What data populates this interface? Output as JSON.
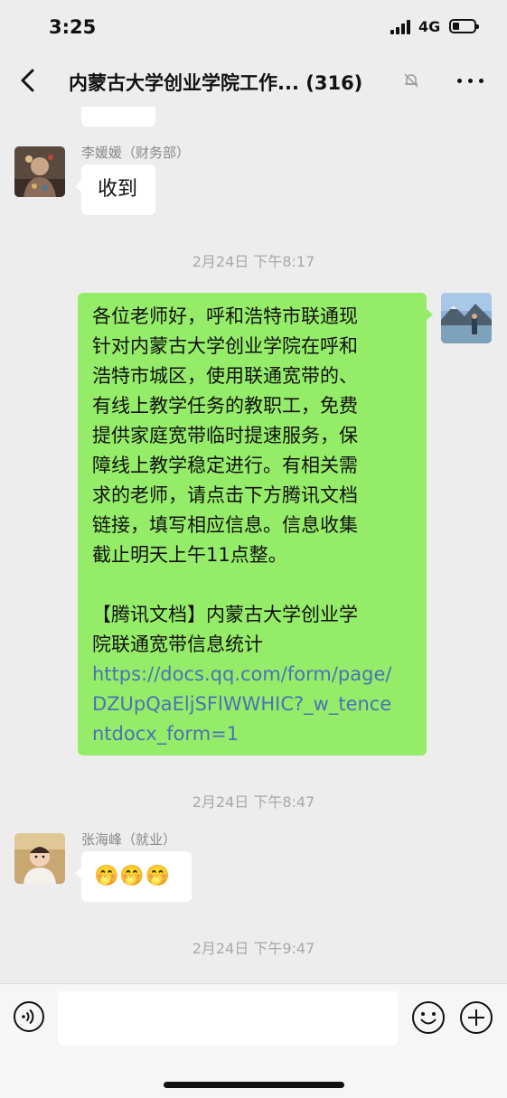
{
  "status_bar": {
    "time": "3:25",
    "network": "4G",
    "icons": [
      "signal-icon",
      "battery-icon"
    ]
  },
  "header": {
    "title": "内蒙古大学创业学院工作... (316)",
    "icons": [
      "back-arrow-icon",
      "mute-bell-icon",
      "more-icon"
    ]
  },
  "messages": [
    {
      "type": "incoming",
      "sender": "李媛媛（财务部）",
      "text": "收到",
      "avatar": "person-in-costume-avatar"
    },
    {
      "type": "timestamp",
      "text": "2月24日 下午8:17"
    },
    {
      "type": "outgoing",
      "avatar": "mountain-lake-avatar",
      "lines": [
        "各位老师好，呼和浩特市联通现",
        "针对内蒙古大学创业学院在呼和",
        "浩特市城区，使用联通宽带的、",
        "有线上教学任务的教职工，免费",
        "提供家庭宽带临时提速服务，保",
        "障线上教学稳定进行。有相关需",
        "求的老师，请点击下方腾讯文档",
        "链接，填写相应信息。信息收集",
        "截止明天上午11点整。",
        "",
        "【腾讯文档】内蒙古大学创业学",
        "院联通宽带信息统计"
      ],
      "link_lines": [
        "https://docs.qq.com/form/page/",
        "DZUpQaEljSFlWWHIC?_w_tence",
        "ntdocx_form=1"
      ]
    },
    {
      "type": "timestamp",
      "text": "2月24日 下午8:47"
    },
    {
      "type": "incoming",
      "sender": "张海峰（就业）",
      "text": "🤭🤭🤭",
      "avatar": "child-avatar"
    },
    {
      "type": "timestamp",
      "text": "2月24日 下午9:47"
    }
  ],
  "input_bar": {
    "placeholder": "",
    "icons": [
      "voice-icon",
      "emoji-icon",
      "plus-icon"
    ]
  },
  "colors": {
    "background": "#ededed",
    "outgoing_bubble": "#95ec69",
    "incoming_bubble": "#ffffff",
    "link": "#4a72b5"
  }
}
